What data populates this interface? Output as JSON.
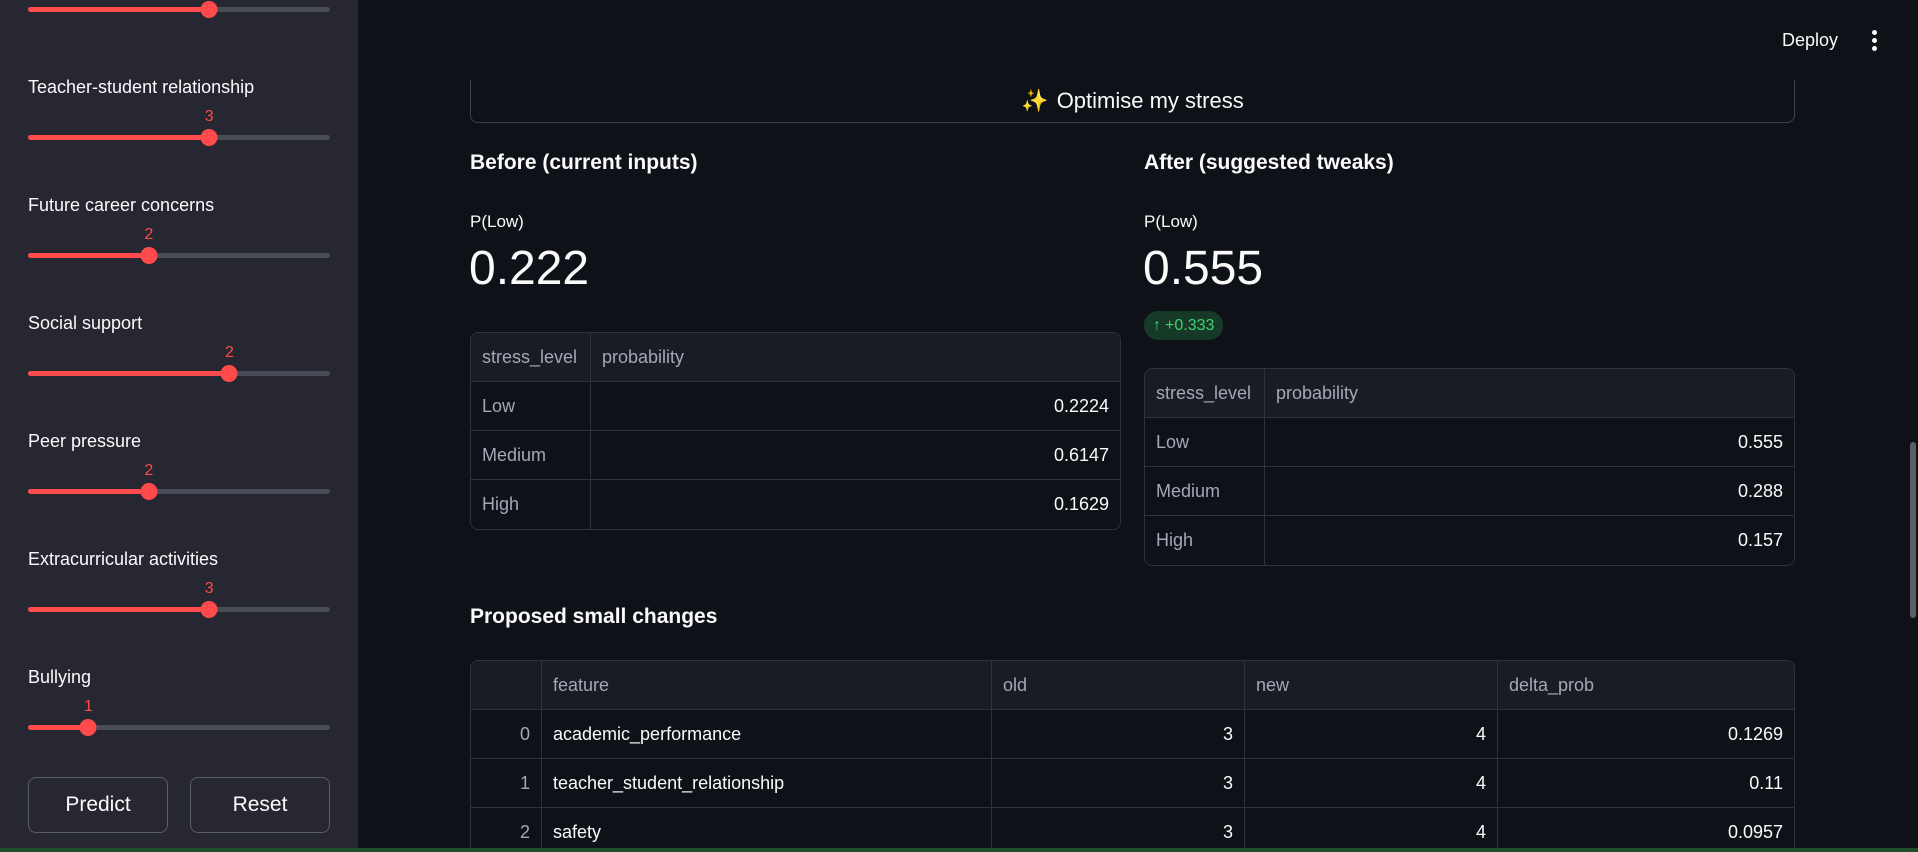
{
  "sidebar": {
    "sliders": [
      {
        "label": "",
        "value": "3",
        "fraction": 0.6
      },
      {
        "label": "Teacher-student relationship",
        "value": "3",
        "fraction": 0.6
      },
      {
        "label": "Future career concerns",
        "value": "2",
        "fraction": 0.4
      },
      {
        "label": "Social support",
        "value": "2",
        "fraction": 0.667
      },
      {
        "label": "Peer pressure",
        "value": "2",
        "fraction": 0.4
      },
      {
        "label": "Extracurricular activities",
        "value": "3",
        "fraction": 0.6
      },
      {
        "label": "Bullying",
        "value": "1",
        "fraction": 0.2
      }
    ],
    "predict_label": "Predict",
    "reset_label": "Reset"
  },
  "header": {
    "deploy_label": "Deploy",
    "menu_icon": "kebab-menu-icon"
  },
  "main": {
    "optimise_label": "Optimise my stress",
    "optimise_icon": "sparkles-icon",
    "before": {
      "title": "Before (current inputs)",
      "metric_label": "P(Low)",
      "metric_value": "0.222",
      "table": {
        "columns": [
          "stress_level",
          "probability"
        ],
        "rows": [
          [
            "Low",
            "0.2224"
          ],
          [
            "Medium",
            "0.6147"
          ],
          [
            "High",
            "0.1629"
          ]
        ]
      }
    },
    "after": {
      "title": "After (suggested tweaks)",
      "metric_label": "P(Low)",
      "metric_value": "0.555",
      "delta": "+0.333",
      "delta_icon": "arrow-up-icon",
      "table": {
        "columns": [
          "stress_level",
          "probability"
        ],
        "rows": [
          [
            "Low",
            "0.555"
          ],
          [
            "Medium",
            "0.288"
          ],
          [
            "High",
            "0.157"
          ]
        ]
      }
    },
    "changes": {
      "title": "Proposed small changes",
      "columns": [
        "",
        "feature",
        "old",
        "new",
        "delta_prob"
      ],
      "rows": [
        [
          "0",
          "academic_performance",
          "3",
          "4",
          "0.1269"
        ],
        [
          "1",
          "teacher_student_relationship",
          "3",
          "4",
          "0.11"
        ],
        [
          "2",
          "safety",
          "3",
          "4",
          "0.0957"
        ]
      ]
    }
  },
  "colors": {
    "accent": "#ff4b4b",
    "background": "#0e1117",
    "sidebar": "#262730",
    "delta_positive": "#3dd56d"
  }
}
